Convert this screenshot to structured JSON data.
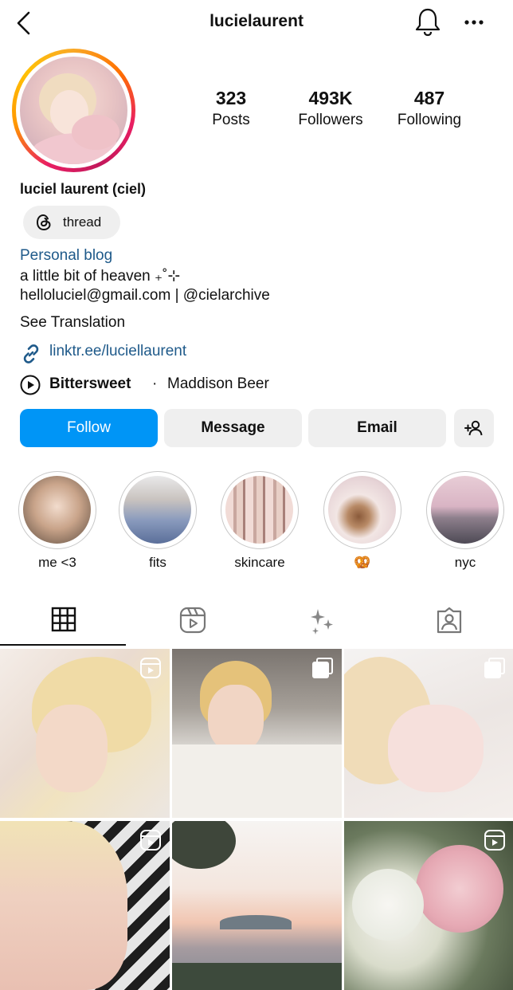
{
  "header": {
    "username": "lucielaurent",
    "back_icon": "chevron-left-icon",
    "notifications_icon": "bell-icon",
    "more_icon": "ellipsis-icon"
  },
  "profile": {
    "avatar_icon": "avatar",
    "stats": [
      {
        "value": "323",
        "label": "Posts"
      },
      {
        "value": "493K",
        "label": "Followers"
      },
      {
        "value": "487",
        "label": "Following"
      }
    ],
    "display_name": "luciel laurent (ciel)",
    "threads_badge": "thread",
    "category": "Personal blog",
    "bio_line1": "a little bit of heaven ₊˚⊹",
    "bio_line2": "helloluciel@gmail.com | @cielarchive",
    "see_translation": "See Translation",
    "link": "linktr.ee/luciellaurent",
    "song": "Bittersweet",
    "separator": "·",
    "artist": "Maddison Beer"
  },
  "actions": {
    "follow": "Follow",
    "message": "Message",
    "email": "Email",
    "add_user_icon": "add-person-icon"
  },
  "highlights": [
    {
      "label": "me <3"
    },
    {
      "label": "fits"
    },
    {
      "label": "skincare"
    },
    {
      "label": "🥨"
    },
    {
      "label": "nyc"
    }
  ],
  "tabs": [
    {
      "name": "grid",
      "icon": "grid-icon",
      "active": true
    },
    {
      "name": "reels",
      "icon": "reels-icon",
      "active": false
    },
    {
      "name": "sparkles",
      "icon": "sparkles-icon",
      "active": false
    },
    {
      "name": "tagged",
      "icon": "tagged-icon",
      "active": false
    }
  ],
  "posts": [
    {
      "type": "reel"
    },
    {
      "type": "carousel"
    },
    {
      "type": "carousel"
    },
    {
      "type": "reel"
    },
    {
      "type": "photo"
    },
    {
      "type": "reel"
    }
  ],
  "colors": {
    "accent": "#0095f6",
    "link": "#1f5a8a",
    "button_bg": "#efefef"
  }
}
